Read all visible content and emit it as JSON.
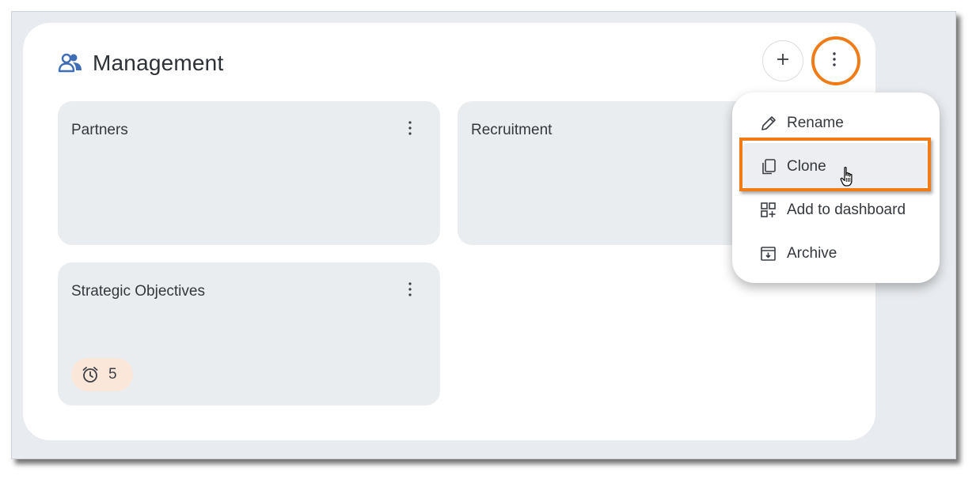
{
  "header": {
    "title": "Management",
    "icon": "people-icon"
  },
  "toolbar": {
    "add_icon": "plus-icon",
    "more_icon": "kebab-vertical-icon"
  },
  "cards": [
    {
      "title": "Partners"
    },
    {
      "title": "Recruitment"
    },
    {
      "title": "Strategic Objectives",
      "badge": {
        "icon": "alarm-clock-icon",
        "count": "5"
      }
    }
  ],
  "menu": {
    "items": [
      {
        "label": "Rename",
        "icon": "pencil-icon"
      },
      {
        "label": "Clone",
        "icon": "copy-icon"
      },
      {
        "label": "Add to dashboard",
        "icon": "add-widget-icon"
      },
      {
        "label": "Archive",
        "icon": "archive-icon"
      }
    ]
  },
  "colors": {
    "highlight": "#f07c18",
    "accent_icon": "#3f6db6",
    "card_bg": "#eaedf0",
    "badge_bg": "#fbe6da"
  }
}
